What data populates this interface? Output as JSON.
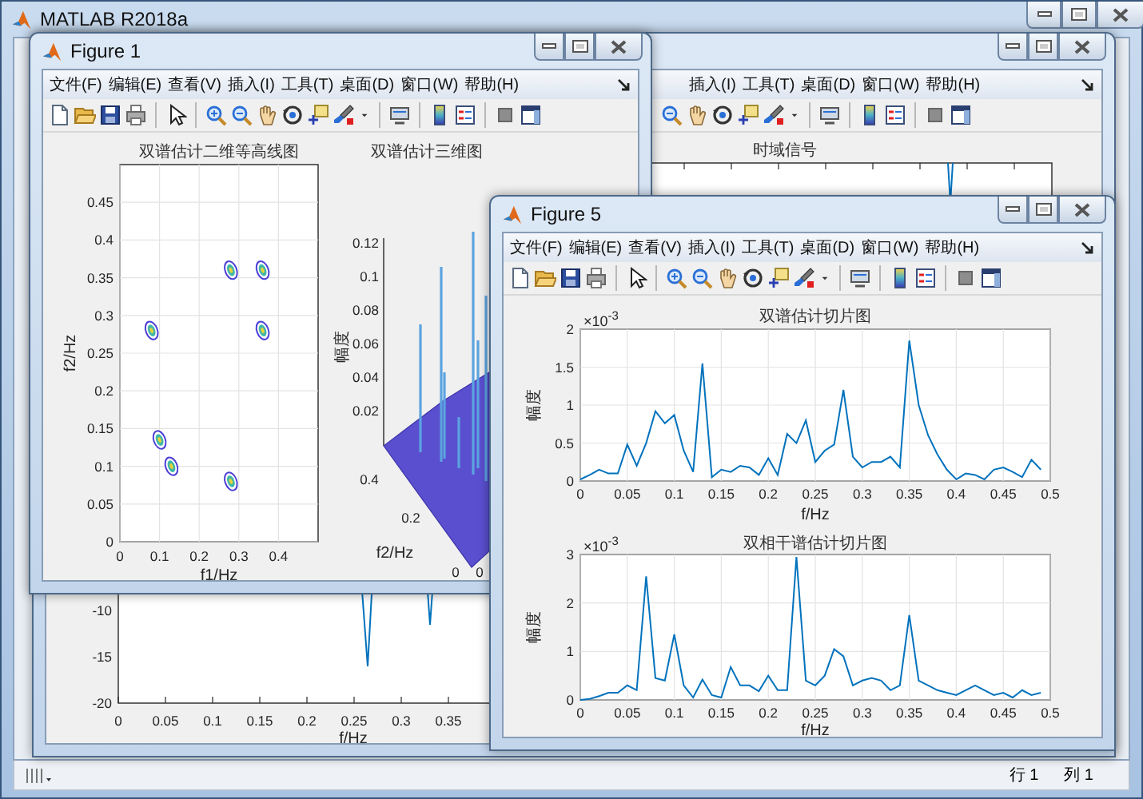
{
  "main_window": {
    "title": "MATLAB R2018a",
    "status_bar": {
      "row": "行 1",
      "column": "列 1"
    }
  },
  "background_figure": {
    "menu": [
      "插入(I)",
      "工具(T)",
      "桌面(D)",
      "窗口(W)",
      "帮助(H)"
    ],
    "signal_plot": {
      "title": "时域信号",
      "xlabel": "f/Hz",
      "xticks": [
        "0",
        "0.05",
        "0.1",
        "0.15",
        "0.2",
        "0.25",
        "0.3",
        "0.35"
      ],
      "yticks": [
        "-10",
        "-15",
        "-20"
      ]
    }
  },
  "figure_1": {
    "title": "Figure 1",
    "menu": [
      "文件(F)",
      "编辑(E)",
      "查看(V)",
      "插入(I)",
      "工具(T)",
      "桌面(D)",
      "窗口(W)",
      "帮助(H)"
    ],
    "contour_plot": {
      "chart_data": {
        "type": "scatter",
        "title": "双谱估计二维等高线图",
        "xlabel": "f1/Hz",
        "ylabel": "f2/Hz",
        "x": [
          0.08,
          0.1,
          0.13,
          0.28,
          0.36,
          0.36,
          0.28
        ],
        "grid": true,
        "series": [
          {
            "color": "#4b3fd6",
            "values": [
              0.28,
              0.135,
              0.1,
              0.36,
              0.36,
              0.28,
              0.08
            ]
          }
        ],
        "xlim": [
          0,
          0.5
        ],
        "ylim": [
          0,
          0.5
        ],
        "xticks": [
          0,
          0.1,
          0.2,
          0.3,
          0.4
        ],
        "yticks": [
          0,
          0.05,
          0.1,
          0.15,
          0.2,
          0.25,
          0.3,
          0.35,
          0.4,
          0.45
        ]
      }
    },
    "surface_plot": {
      "title": "双谱估计三维图",
      "zlabel": "幅度",
      "ylabel": "f2/Hz",
      "zticks": [
        "0.12",
        "0.1",
        "0.08",
        "0.06",
        "0.04",
        "0.02"
      ],
      "yticks": [
        "0.4",
        "0.2"
      ],
      "corner_labels": [
        "0",
        "0"
      ]
    }
  },
  "figure_5": {
    "title": "Figure 5",
    "menu": [
      "文件(F)",
      "编辑(E)",
      "查看(V)",
      "插入(I)",
      "工具(T)",
      "桌面(D)",
      "窗口(W)",
      "帮助(H)"
    ],
    "slice_plots": [
      {
        "exponent": "×10$^{-3}$",
        "chart_data": {
          "type": "line",
          "title": "双谱估计切片图",
          "xlabel": "f/Hz",
          "ylabel": "幅度",
          "x": [
            0,
            0.01,
            0.02,
            0.03,
            0.04,
            0.05,
            0.06,
            0.07,
            0.08,
            0.09,
            0.1,
            0.11,
            0.12,
            0.13,
            0.14,
            0.15,
            0.16,
            0.17,
            0.18,
            0.19,
            0.2,
            0.21,
            0.22,
            0.23,
            0.24,
            0.25,
            0.26,
            0.27,
            0.28,
            0.29,
            0.3,
            0.31,
            0.32,
            0.33,
            0.34,
            0.35,
            0.36,
            0.37,
            0.38,
            0.39,
            0.4,
            0.41,
            0.42,
            0.43,
            0.44,
            0.45,
            0.46,
            0.47,
            0.48,
            0.49
          ],
          "grid": true,
          "series": [
            {
              "color": "#0072bd",
              "values": [
                0.02,
                0.08,
                0.15,
                0.1,
                0.1,
                0.48,
                0.2,
                0.5,
                0.92,
                0.76,
                0.87,
                0.4,
                0.12,
                1.55,
                0.05,
                0.15,
                0.12,
                0.2,
                0.18,
                0.08,
                0.3,
                0.08,
                0.62,
                0.5,
                0.8,
                0.25,
                0.4,
                0.48,
                1.2,
                0.32,
                0.18,
                0.25,
                0.25,
                0.32,
                0.18,
                1.85,
                1.0,
                0.6,
                0.35,
                0.15,
                0.02,
                0.1,
                0.08,
                0.02,
                0.15,
                0.18,
                0.12,
                0.05,
                0.28,
                0.15
              ]
            }
          ],
          "xlim": [
            0,
            0.5
          ],
          "ylim": [
            0,
            2
          ],
          "xticks": [
            0,
            0.05,
            0.1,
            0.15,
            0.2,
            0.25,
            0.3,
            0.35,
            0.4,
            0.45,
            0.5
          ],
          "yticks": [
            0,
            0.5,
            1,
            1.5,
            2
          ]
        }
      },
      {
        "exponent": "×10$^{-3}$",
        "chart_data": {
          "type": "line",
          "title": "双相干谱估计切片图",
          "xlabel": "f/Hz",
          "ylabel": "幅度",
          "x": [
            0,
            0.01,
            0.02,
            0.03,
            0.04,
            0.05,
            0.06,
            0.07,
            0.08,
            0.09,
            0.1,
            0.11,
            0.12,
            0.13,
            0.14,
            0.15,
            0.16,
            0.17,
            0.18,
            0.19,
            0.2,
            0.21,
            0.22,
            0.23,
            0.24,
            0.25,
            0.26,
            0.27,
            0.28,
            0.29,
            0.3,
            0.31,
            0.32,
            0.33,
            0.34,
            0.35,
            0.36,
            0.37,
            0.38,
            0.39,
            0.4,
            0.41,
            0.42,
            0.43,
            0.44,
            0.45,
            0.46,
            0.47,
            0.48,
            0.49
          ],
          "grid": true,
          "series": [
            {
              "color": "#0072bd",
              "values": [
                0,
                0.02,
                0.08,
                0.15,
                0.15,
                0.3,
                0.2,
                2.55,
                0.45,
                0.4,
                1.35,
                0.3,
                0.05,
                0.42,
                0.1,
                0.05,
                0.68,
                0.3,
                0.3,
                0.18,
                0.5,
                0.2,
                0.2,
                2.95,
                0.4,
                0.3,
                0.5,
                1.05,
                0.9,
                0.3,
                0.4,
                0.45,
                0.4,
                0.2,
                0.3,
                1.75,
                0.4,
                0.3,
                0.2,
                0.15,
                0.1,
                0.2,
                0.3,
                0.2,
                0.1,
                0.15,
                0.05,
                0.2,
                0.1,
                0.15
              ]
            }
          ],
          "xlim": [
            0,
            0.5
          ],
          "ylim": [
            0,
            3
          ],
          "xticks": [
            0,
            0.05,
            0.1,
            0.15,
            0.2,
            0.25,
            0.3,
            0.35,
            0.4,
            0.45,
            0.5
          ],
          "yticks": [
            0,
            1,
            2,
            3
          ]
        }
      }
    ]
  }
}
